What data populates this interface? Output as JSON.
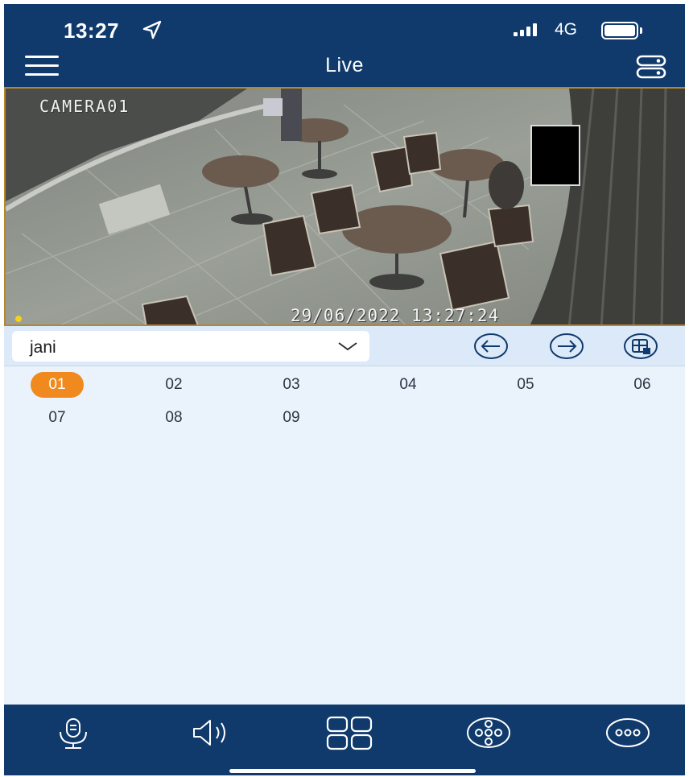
{
  "status_bar": {
    "time": "13:27",
    "network": "4G",
    "location_icon": "location-arrow-icon",
    "signal_icon": "signal-bars-icon",
    "battery_icon": "battery-icon"
  },
  "header": {
    "title": "Live",
    "menu_icon": "hamburger-menu-icon",
    "device_icon": "device-list-icon",
    "background": "#0f3a6b"
  },
  "video": {
    "camera_label": "CAMERA01",
    "timestamp": "29/06/2022 13:27:24"
  },
  "controls": {
    "device_select_value": "jani",
    "prev_icon": "arrow-left-circle-icon",
    "next_icon": "arrow-right-circle-icon",
    "layout_icon": "split-screen-icon"
  },
  "channels": {
    "items": [
      "01",
      "02",
      "03",
      "04",
      "05",
      "06",
      "07",
      "08",
      "09"
    ],
    "selected": "01",
    "accent": "#f08a1e"
  },
  "bottom_bar": {
    "icons": [
      "intercom-icon",
      "speaker-icon",
      "grid-view-icon",
      "ptz-icon",
      "more-icon"
    ]
  }
}
